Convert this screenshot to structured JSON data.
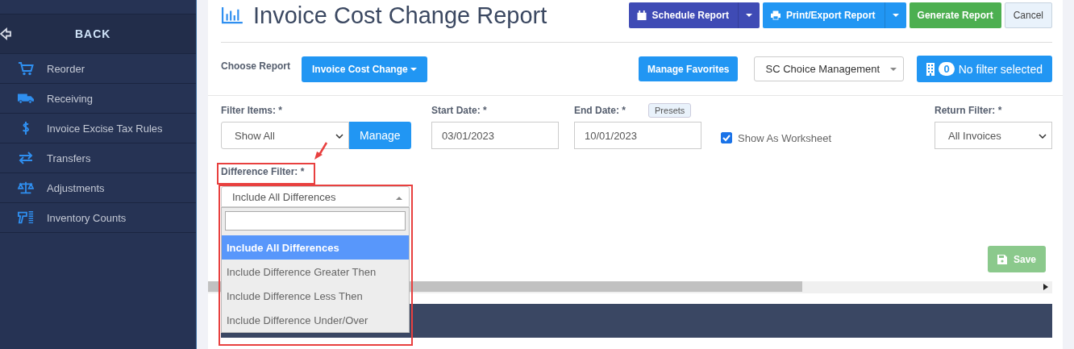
{
  "sidebar": {
    "back": "BACK",
    "items": [
      {
        "label": "Reorder"
      },
      {
        "label": "Receiving"
      },
      {
        "label": "Invoice Excise Tax Rules"
      },
      {
        "label": "Transfers"
      },
      {
        "label": "Adjustments"
      },
      {
        "label": "Inventory Counts"
      }
    ]
  },
  "header": {
    "title": "Invoice Cost Change Report",
    "buttons": [
      {
        "label": "Schedule Report",
        "kind": "schedule"
      },
      {
        "label": "Print/Export Report",
        "kind": "print"
      },
      {
        "label": "Generate Report",
        "kind": "generate"
      },
      {
        "label": "Cancel",
        "kind": "cancel"
      }
    ]
  },
  "report_row": {
    "label": "Choose Report",
    "report": "Invoice Cost Change",
    "favorites": "Manage Favorites",
    "company": "SC Choice Management",
    "filter_count": "0",
    "filter_text": "No filter selected"
  },
  "filters": {
    "filter_items": {
      "label": "Filter Items: *",
      "value": "Show All",
      "button": "Manage"
    },
    "start_date": {
      "label": "Start Date: *",
      "value": "03/01/2023"
    },
    "end_date": {
      "label": "End Date: *",
      "value": "10/01/2023",
      "presets": "Presets"
    },
    "worksheet": {
      "label": "Show As Worksheet",
      "checked": true
    },
    "return_filter": {
      "label": "Return Filter: *",
      "value": "All Invoices"
    },
    "difference_filter": {
      "label": "Difference Filter: *",
      "value": "Include All Differences",
      "expanded": true,
      "options": [
        {
          "label": "Include All Differences",
          "selected": true
        },
        {
          "label": "Include Difference Greater Then",
          "selected": false
        },
        {
          "label": "Include Difference Less Then",
          "selected": false
        },
        {
          "label": "Include Difference Under/Over",
          "selected": false
        }
      ]
    }
  },
  "save": {
    "label": "Save",
    "disabled": true
  }
}
